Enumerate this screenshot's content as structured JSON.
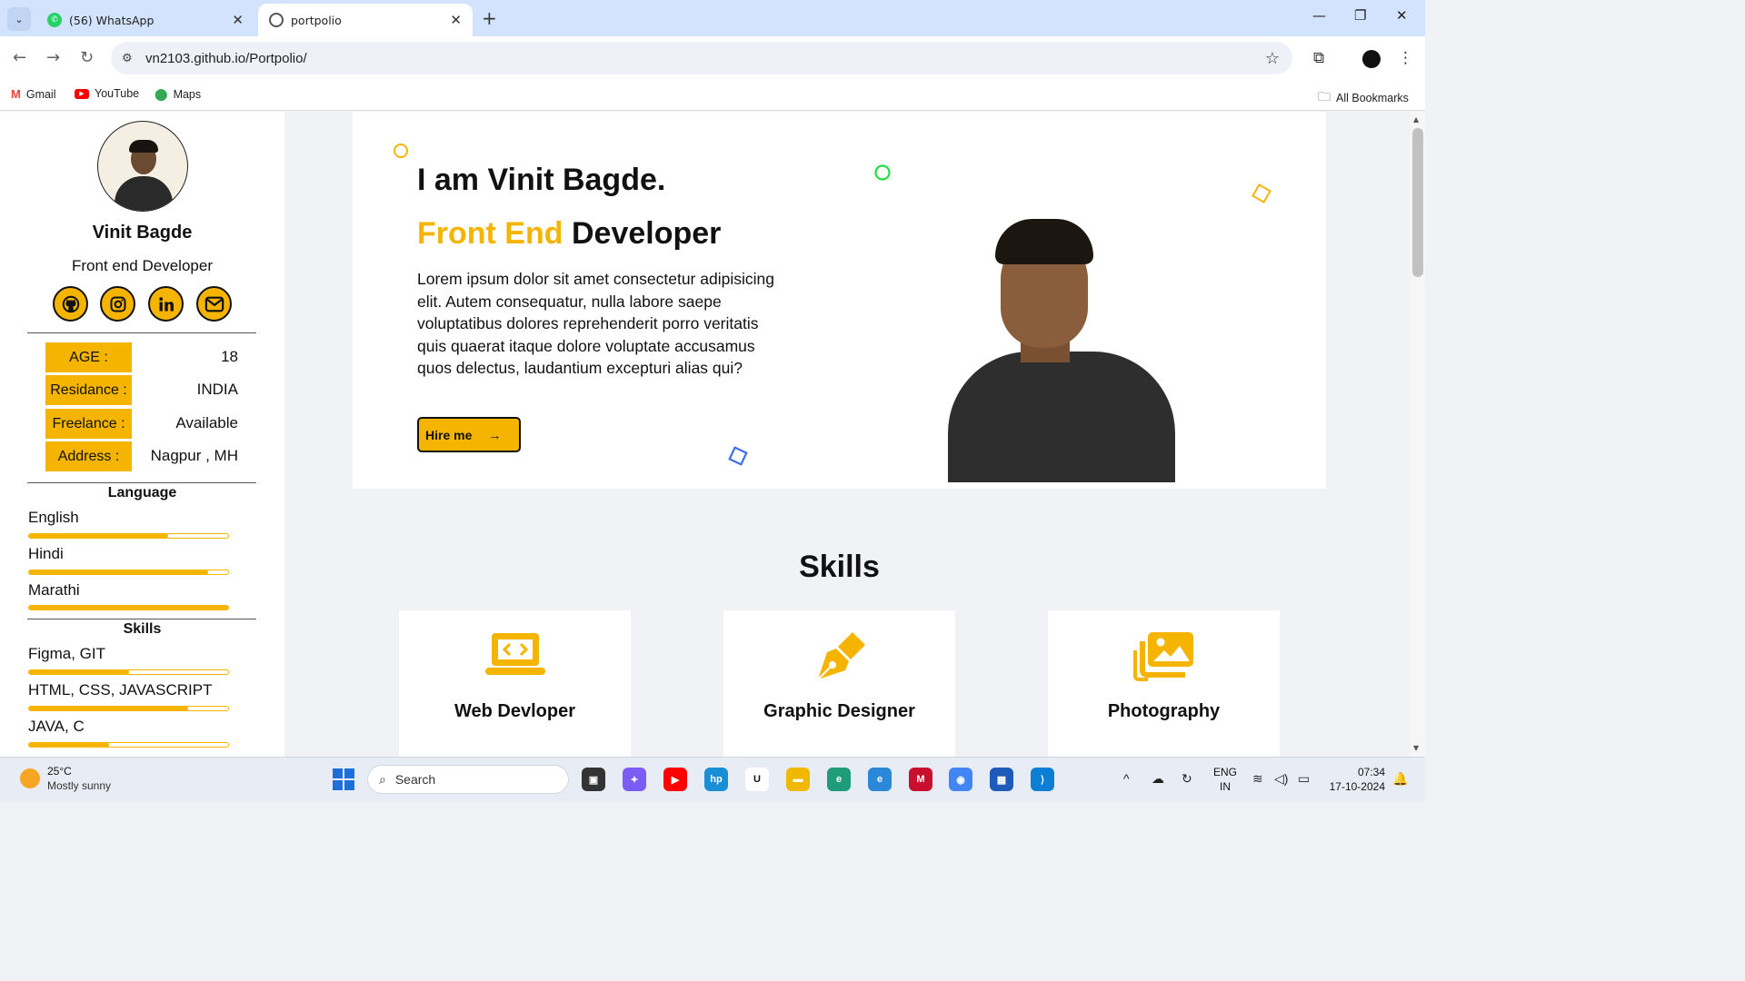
{
  "browser": {
    "tabs": [
      {
        "label": "(56) WhatsApp",
        "icon": "whatsapp-icon",
        "active": false
      },
      {
        "label": "portpolio",
        "icon": "globe-icon",
        "active": true
      }
    ],
    "url": "vn2103.github.io/Portpolio/",
    "bookmarks": [
      "Gmail",
      "YouTube",
      "Maps"
    ],
    "all_bookmarks": "All Bookmarks"
  },
  "sidebar": {
    "name": "Vinit Bagde",
    "role": "Front end Developer",
    "socials": [
      "github-icon",
      "instagram-icon",
      "linkedin-icon",
      "email-icon"
    ],
    "info": [
      {
        "key": "AGE :",
        "value": "18"
      },
      {
        "key": "Residance :",
        "value": "INDIA"
      },
      {
        "key": "Freelance :",
        "value": "Available"
      },
      {
        "key": "Address :",
        "value": "Nagpur , MH"
      }
    ],
    "language_heading": "Language",
    "languages": [
      {
        "name": "English",
        "level": 0.7
      },
      {
        "name": "Hindi",
        "level": 0.9
      },
      {
        "name": "Marathi",
        "level": 1.0
      }
    ],
    "skills_heading": "Skills",
    "skills": [
      {
        "name": "Figma, GIT",
        "level": 0.5
      },
      {
        "name": "HTML, CSS, JAVASCRIPT",
        "level": 0.8
      },
      {
        "name": "JAVA, C",
        "level": 0.4
      }
    ]
  },
  "hero": {
    "heading": "I am Vinit Bagde.",
    "subheading_accent": "Front End",
    "subheading_rest": " Developer",
    "description": "Lorem ipsum dolor sit amet consectetur adipisicing elit. Autem consequatur, nulla labore saepe voluptatibus dolores reprehenderit porro veritatis quis quaerat itaque dolore voluptate accusamus quos delectus, laudantium excepturi alias qui?",
    "cta": "Hire me"
  },
  "skills_section": {
    "title": "Skills",
    "cards": [
      {
        "label": "Web Devloper",
        "icon": "laptop-code-icon"
      },
      {
        "label": "Graphic Designer",
        "icon": "pen-nib-icon"
      },
      {
        "label": "Photography",
        "icon": "photo-gallery-icon"
      }
    ]
  },
  "taskbar": {
    "temperature": "25°C",
    "weather": "Mostly sunny",
    "search_placeholder": "Search",
    "lang_line1": "ENG",
    "lang_line2": "IN",
    "time": "07:34",
    "date": "17-10-2024"
  },
  "colors": {
    "accent": "#f5b400",
    "text": "#111111",
    "page_bg": "#f1f2f6"
  }
}
